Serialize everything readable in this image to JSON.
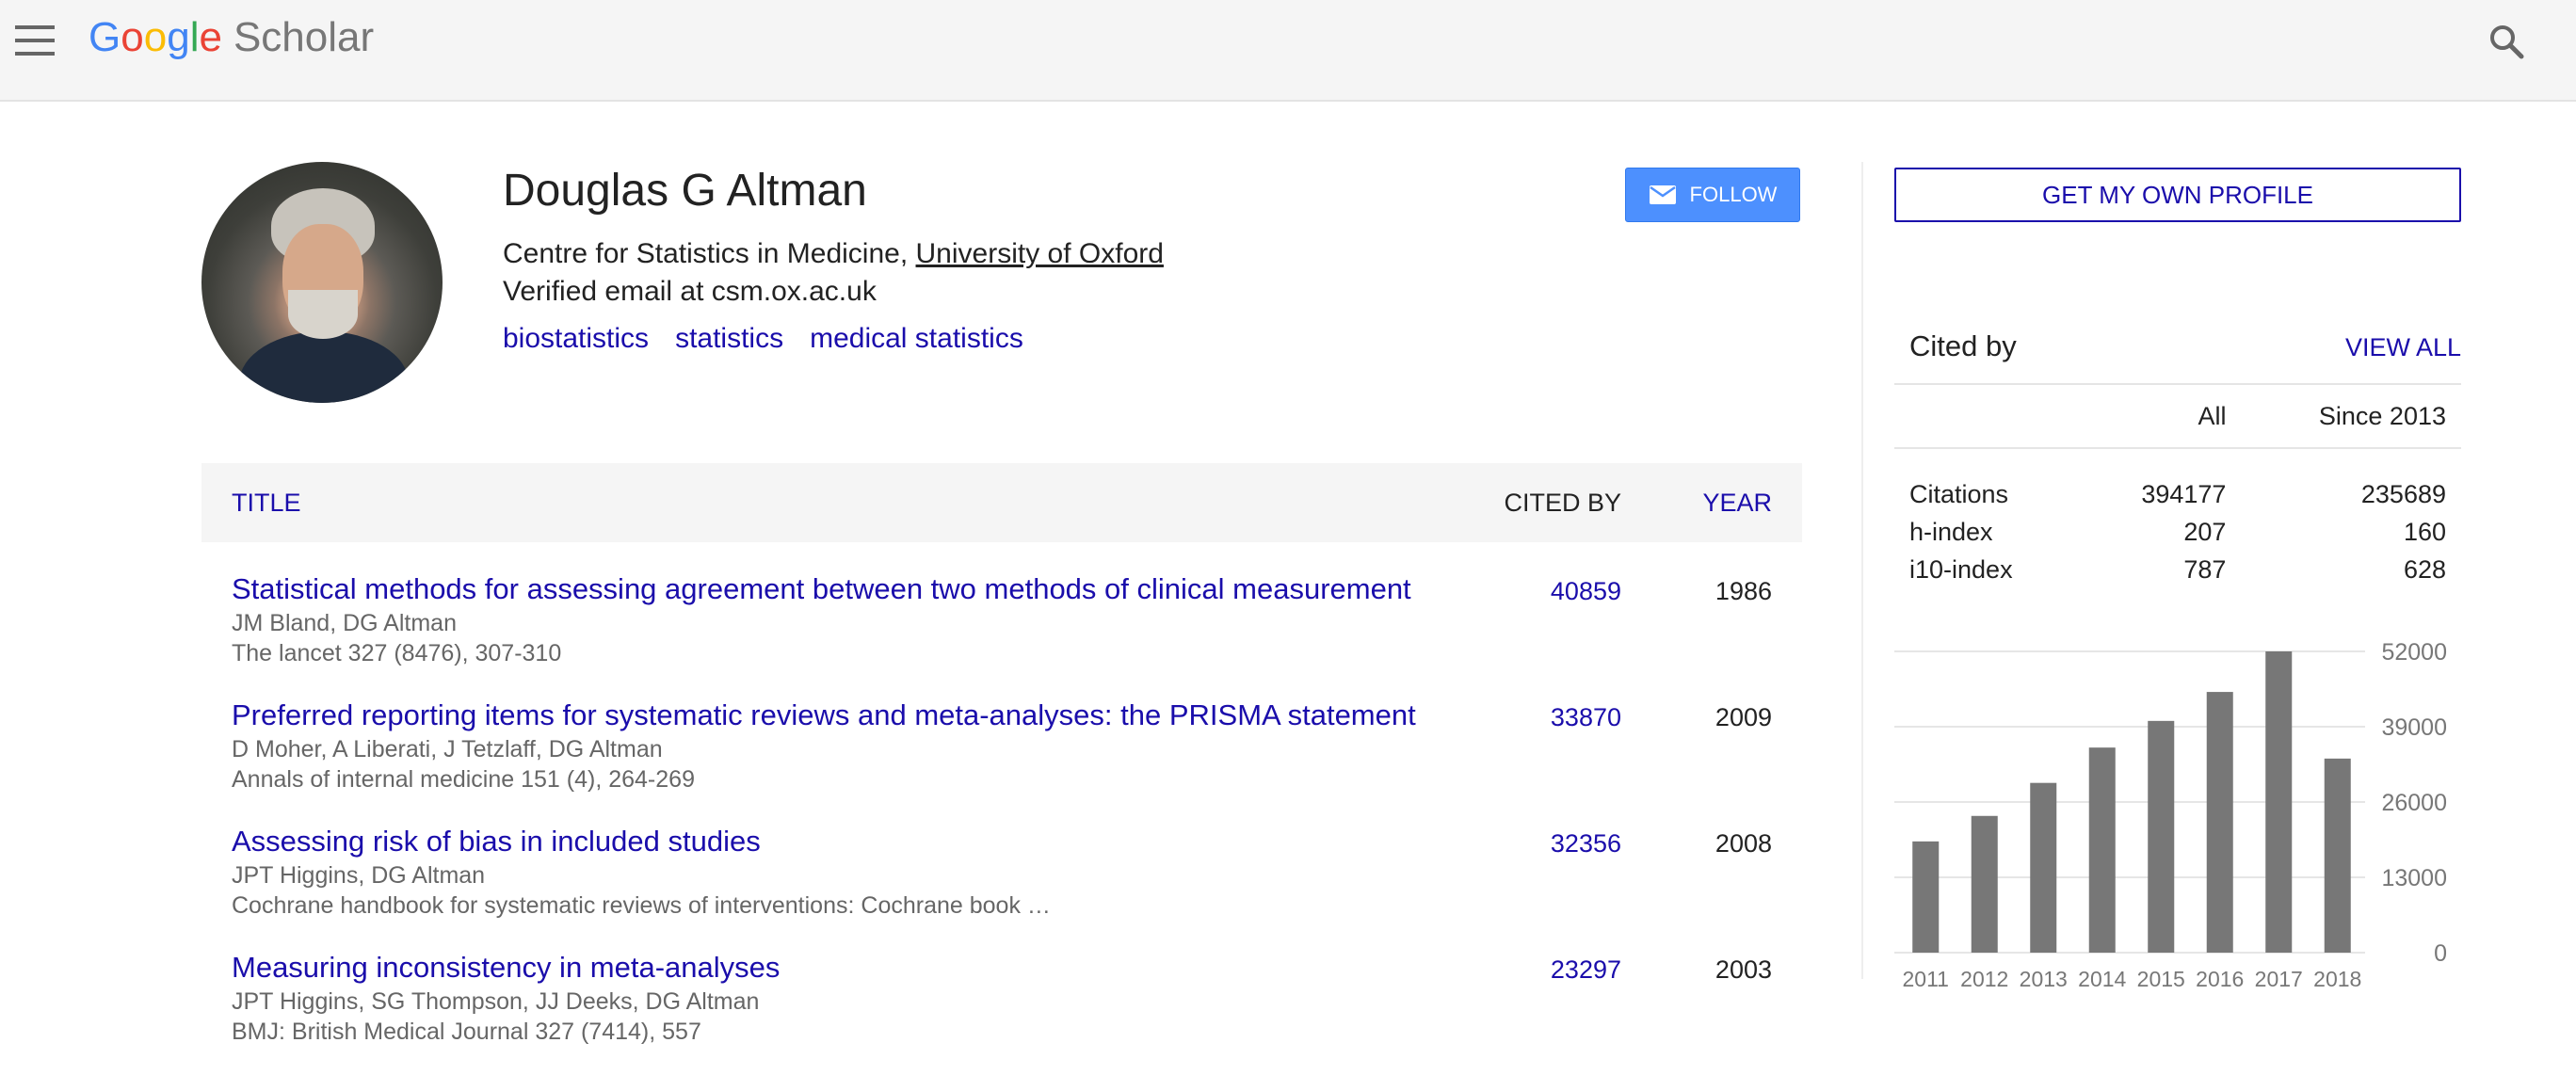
{
  "header": {
    "logo_google_letters": [
      {
        "char": "G",
        "color": "#4285F4"
      },
      {
        "char": "o",
        "color": "#EA4335"
      },
      {
        "char": "o",
        "color": "#FBBC05"
      },
      {
        "char": "g",
        "color": "#4285F4"
      },
      {
        "char": "l",
        "color": "#34A853"
      },
      {
        "char": "e",
        "color": "#EA4335"
      }
    ],
    "logo_scholar": "Scholar",
    "menu_icon": "hamburger-menu-icon",
    "search_icon": "search-icon"
  },
  "profile": {
    "name": "Douglas G Altman",
    "affiliation_prefix": "Centre for Statistics in Medicine, ",
    "affiliation_link": "University of Oxford",
    "email": "Verified email at csm.ox.ac.uk",
    "interests": [
      "biostatistics",
      "statistics",
      "medical statistics"
    ],
    "follow_label": "FOLLOW",
    "follow_icon": "mail-icon"
  },
  "sidebar": {
    "get_profile_label": "GET MY OWN PROFILE",
    "cited_by_title": "Cited by",
    "view_all_label": "VIEW ALL",
    "columns": [
      "",
      "All",
      "Since 2013"
    ],
    "rows": [
      {
        "label": "Citations",
        "all": "394177",
        "since": "235689"
      },
      {
        "label": "h-index",
        "all": "207",
        "since": "160"
      },
      {
        "label": "i10-index",
        "all": "787",
        "since": "628"
      }
    ]
  },
  "chart_data": {
    "type": "bar",
    "categories": [
      "2011",
      "2012",
      "2013",
      "2014",
      "2015",
      "2016",
      "2017",
      "2018"
    ],
    "values": [
      19200,
      23600,
      29300,
      35400,
      40000,
      45000,
      52000,
      33500
    ],
    "ylim": [
      0,
      52000
    ],
    "yticks": [
      "52000",
      "39000",
      "26000",
      "13000",
      "0"
    ],
    "bar_color": "#777777",
    "grid": true
  },
  "publications": {
    "header": {
      "title": "TITLE",
      "cited_by": "CITED BY",
      "year": "YEAR"
    },
    "rows": [
      {
        "title": "Statistical methods for assessing agreement between two methods of clinical measurement",
        "authors": "JM Bland, DG Altman",
        "venue": "The lancet 327 (8476), 307-310",
        "cited_by": "40859",
        "year": "1986"
      },
      {
        "title": "Preferred reporting items for systematic reviews and meta-analyses: the PRISMA statement",
        "authors": "D Moher, A Liberati, J Tetzlaff, DG Altman",
        "venue": "Annals of internal medicine 151 (4), 264-269",
        "cited_by": "33870",
        "year": "2009"
      },
      {
        "title": "Assessing risk of bias in included studies",
        "authors": "JPT Higgins, DG Altman",
        "venue": "Cochrane handbook for systematic reviews of interventions: Cochrane book …",
        "cited_by": "32356",
        "year": "2008"
      },
      {
        "title": "Measuring inconsistency in meta-analyses",
        "authors": "JPT Higgins, SG Thompson, JJ Deeks, DG Altman",
        "venue": "BMJ: British Medical Journal 327 (7414), 557",
        "cited_by": "23297",
        "year": "2003"
      }
    ]
  }
}
